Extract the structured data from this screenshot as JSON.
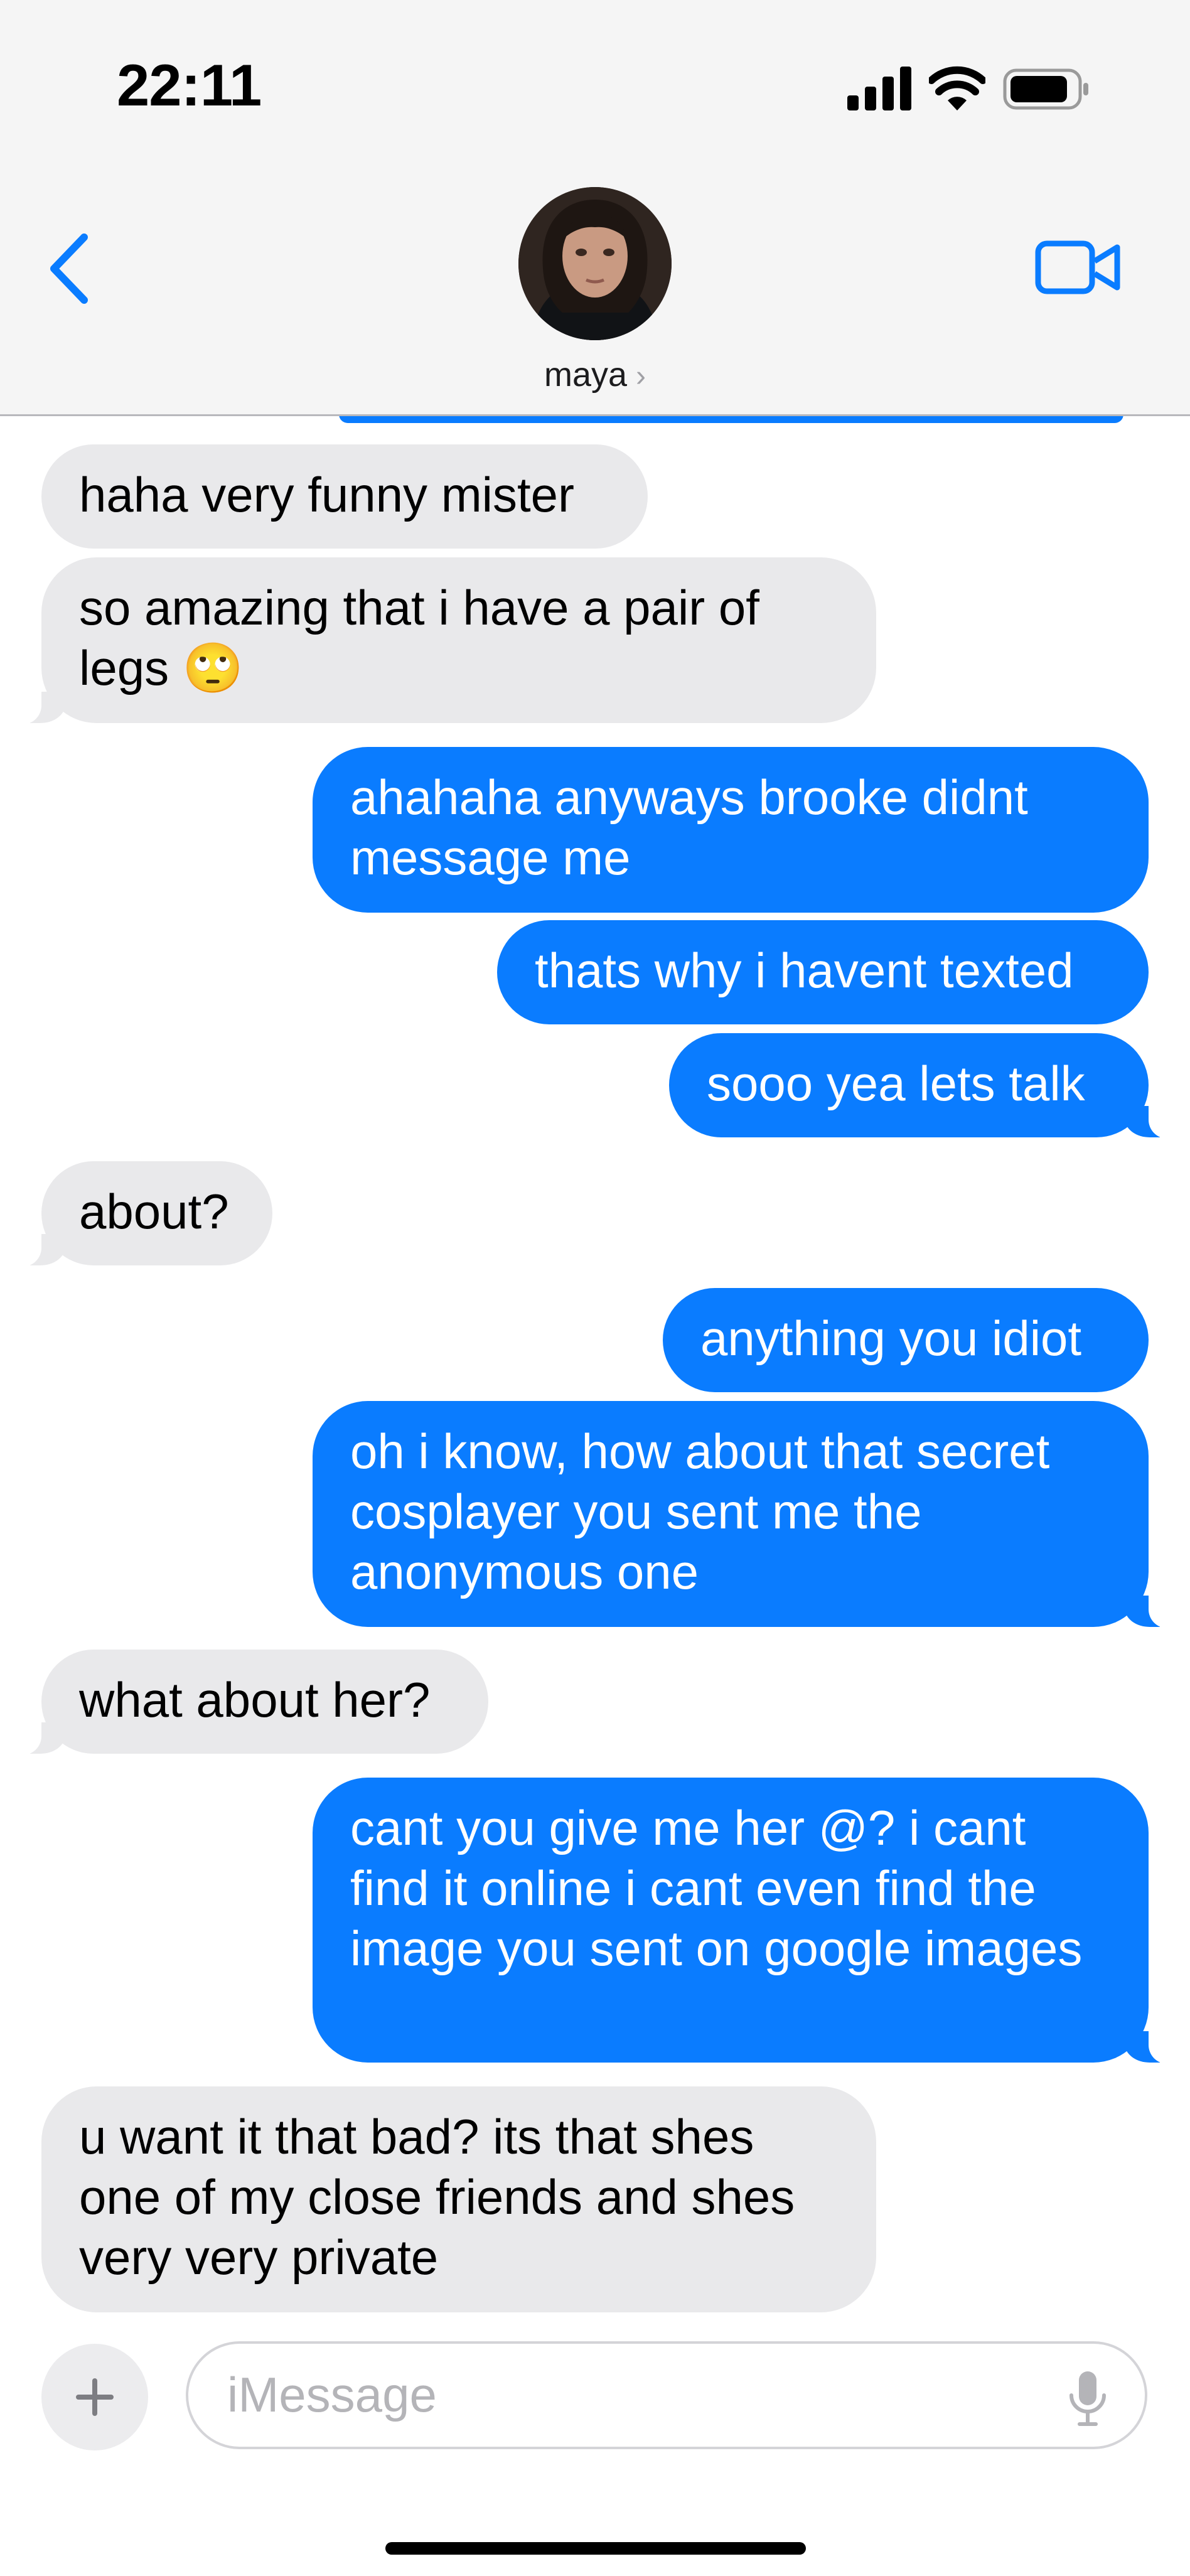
{
  "status_bar": {
    "time": "22:11"
  },
  "header": {
    "contact_name": "maya",
    "name_chevron": "›"
  },
  "messages": [
    {
      "from": "them",
      "text": "haha very funny mister"
    },
    {
      "from": "them",
      "text": "so amazing that i have a pair of legs 🙄"
    },
    {
      "from": "me",
      "text": "ahahaha anyways brooke didnt message me"
    },
    {
      "from": "me",
      "text": "thats why i havent texted"
    },
    {
      "from": "me",
      "text": "sooo yea lets talk"
    },
    {
      "from": "them",
      "text": "about?"
    },
    {
      "from": "me",
      "text": "anything you idiot"
    },
    {
      "from": "me",
      "text": "oh i know, how about that secret cosplayer you sent me the anonymous one"
    },
    {
      "from": "them",
      "text": "what about her?"
    },
    {
      "from": "me",
      "text": "cant you give me her @? i cant find it online i cant even find the image you sent on google images"
    },
    {
      "from": "them",
      "text": "u want it that bad? its that shes one of my close friends and shes very very private"
    }
  ],
  "compose": {
    "placeholder": "iMessage",
    "plus_label": "+"
  },
  "icons": {
    "back": "chevron-left-icon",
    "video": "video-camera-icon",
    "mic": "microphone-icon",
    "add": "plus-icon"
  },
  "colors": {
    "sent_bubble": "#0a7cff",
    "received_bubble": "#e9e9eb",
    "accent": "#0a7cff"
  }
}
